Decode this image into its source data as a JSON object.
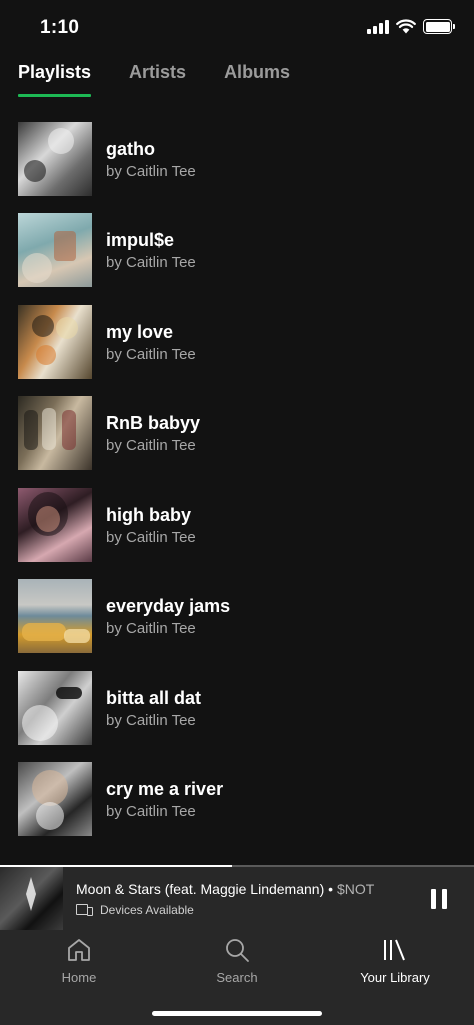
{
  "status_bar": {
    "time": "1:10",
    "icons": [
      "cellular-signal-icon",
      "wifi-icon",
      "battery-icon"
    ]
  },
  "tabs": [
    {
      "label": "Playlists",
      "active": true
    },
    {
      "label": "Artists",
      "active": false
    },
    {
      "label": "Albums",
      "active": false
    }
  ],
  "playlists": [
    {
      "title": "gatho",
      "subtitle": "by Caitlin Tee"
    },
    {
      "title": "impul$e",
      "subtitle": "by Caitlin Tee"
    },
    {
      "title": "my love",
      "subtitle": "by Caitlin Tee"
    },
    {
      "title": "RnB babyy",
      "subtitle": "by Caitlin Tee"
    },
    {
      "title": "high baby",
      "subtitle": "by Caitlin Tee"
    },
    {
      "title": "everyday jams",
      "subtitle": "by Caitlin Tee"
    },
    {
      "title": "bitta all dat",
      "subtitle": "by Caitlin Tee"
    },
    {
      "title": "cry me a river",
      "subtitle": "by Caitlin Tee"
    }
  ],
  "now_playing": {
    "track": "Moon & Stars (feat. Maggie Lindemann)",
    "separator": " • ",
    "artist": "$NOT",
    "devices_label": "Devices Available",
    "progress": 0.49
  },
  "nav": {
    "home": "Home",
    "search": "Search",
    "library": "Your Library",
    "active": "library"
  },
  "colors": {
    "background": "#121212",
    "accent": "#1db954",
    "bar": "#282828"
  }
}
